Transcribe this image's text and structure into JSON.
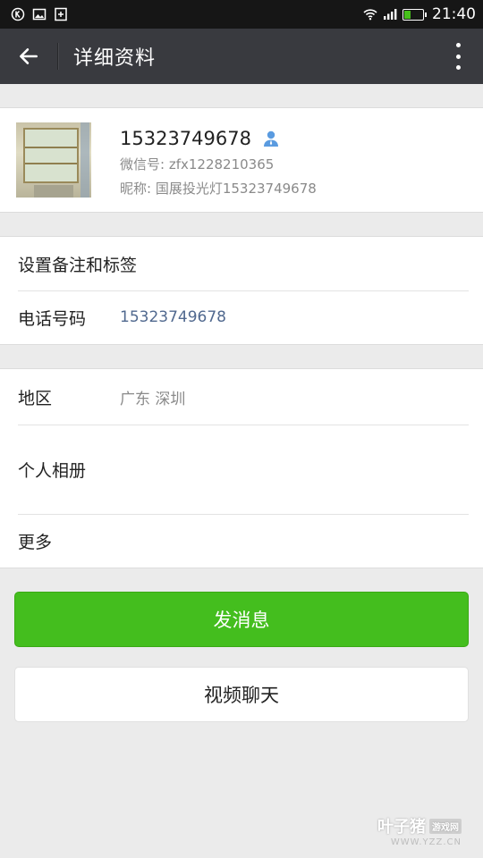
{
  "status_bar": {
    "time": "21:40"
  },
  "header": {
    "title": "详细资料"
  },
  "profile": {
    "name": "15323749678",
    "wechat_id": "微信号: zfx1228210365",
    "nickname": "昵称: 国展投光灯15323749678"
  },
  "section1": {
    "remark_label": "设置备注和标签",
    "phone_label": "电话号码",
    "phone_value": "15323749678"
  },
  "section2": {
    "region_label": "地区",
    "region_value": "广东  深圳",
    "album_label": "个人相册",
    "more_label": "更多"
  },
  "buttons": {
    "send_message": "发消息",
    "video_chat": "视频聊天"
  },
  "watermark": {
    "brand": "叶子猪",
    "tag": "游戏网",
    "url": "WWW.YZZ.CN"
  },
  "colors": {
    "accent_green": "#44be1e",
    "header_bg": "#393a3f",
    "link_blue": "#51698f"
  },
  "icons": [
    "back-arrow-icon",
    "more-vertical-icon",
    "contact-person-icon",
    "wifi-icon",
    "signal-icon",
    "battery-icon"
  ]
}
